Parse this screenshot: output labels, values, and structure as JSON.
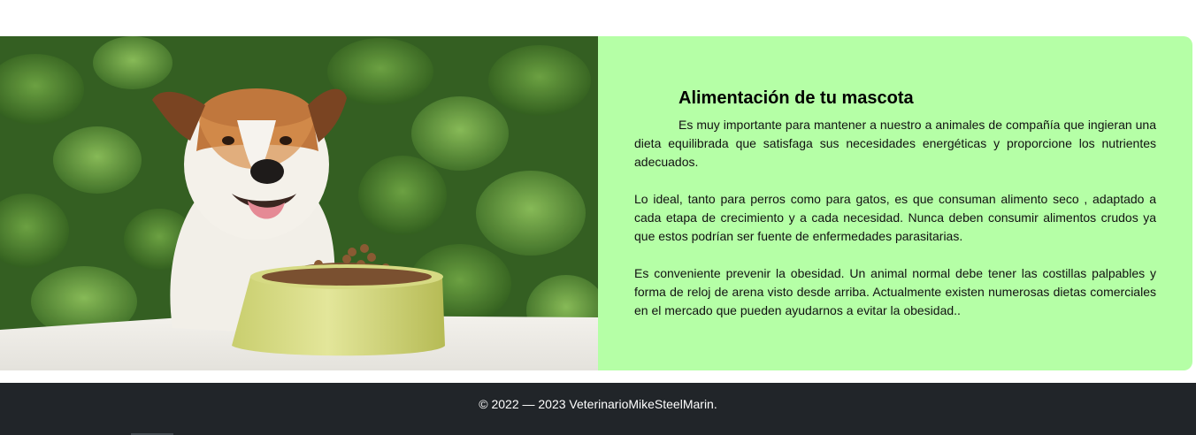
{
  "article": {
    "title": "Alimentación de tu mascota",
    "paragraphs": [
      "Es muy importante para mantener a nuestro a animales de compañía que ingieran una dieta equilibrada que satisfaga sus necesidades energéticas y proporcione los nutrientes adecuados.",
      "Lo ideal, tanto para perros como para gatos, es que consuman alimento seco , adaptado a cada etapa de crecimiento y a cada necesidad. Nunca deben consumir alimentos crudos ya que estos podrían ser fuente de enfermedades parasitarias.",
      "Es conveniente prevenir la obesidad. Un animal normal debe tener las costillas palpables y forma de reloj de arena visto desde arriba. Actualmente existen numerosas dietas comerciales en el mercado que pueden ayudarnos a evitar la obesidad.."
    ]
  },
  "footer": {
    "copyright": "© 2022 — 2023 VeterinarioMikeSteelMarin."
  },
  "colors": {
    "card_background": "#b5ffa6",
    "footer_background": "#212529"
  }
}
